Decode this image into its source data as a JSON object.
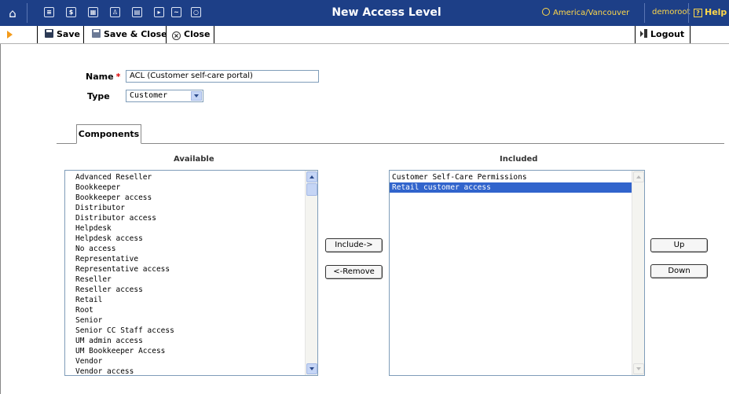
{
  "header": {
    "title": "New Access Level",
    "timezone": "America/Vancouver",
    "user": "demoroot",
    "help_label": "Help",
    "nav_icons": [
      "home-icon",
      "list-icon",
      "dollar-icon",
      "grid-icon",
      "person-icon",
      "document-icon",
      "forward-icon",
      "chart-icon",
      "search-icon"
    ]
  },
  "toolbar": {
    "save_label": "Save",
    "save_close_label": "Save & Close",
    "close_label": "Close",
    "logout_label": "Logout"
  },
  "form": {
    "name_label": "Name",
    "name_value": "ACL (Customer self-care portal)",
    "type_label": "Type",
    "type_value": "Customer"
  },
  "tab": {
    "label": "Components"
  },
  "available": {
    "title": "Available",
    "items": [
      "Advanced Reseller",
      "Bookkeeper",
      "Bookkeeper access",
      "Distributor",
      "Distributor access",
      "Helpdesk",
      "Helpdesk access",
      "No access",
      "Representative",
      "Representative access",
      "Reseller",
      "Reseller access",
      "Retail",
      "Root",
      "Senior",
      "Senior CC Staff access",
      "UM admin access",
      "UM Bookkeeper Access",
      "Vendor",
      "Vendor access"
    ]
  },
  "included": {
    "title": "Included",
    "items": [
      "Customer Self-Care Permissions",
      "Retail customer access"
    ],
    "selected_index": 1
  },
  "buttons": {
    "include": "Include->",
    "remove": "<-Remove",
    "up": "Up",
    "down": "Down"
  },
  "colors": {
    "header_bg": "#1d3f87",
    "accent_yellow": "#ffd84a",
    "selection": "#3164cc"
  }
}
